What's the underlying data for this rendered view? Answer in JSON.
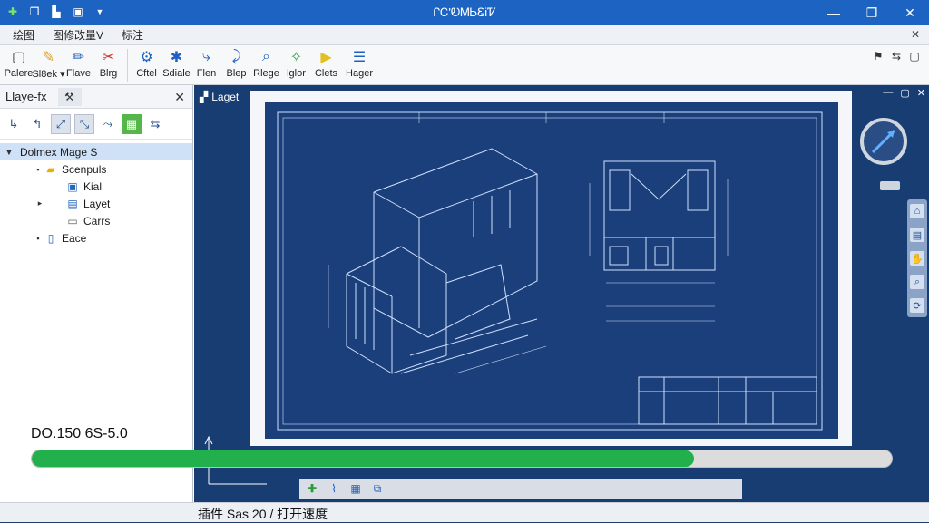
{
  "app": {
    "title": "ᒋᏟ'ᎧᎷᏏᏋᎥᏤ"
  },
  "quick_access": [
    "plus-green-icon",
    "copy-icon",
    "save-icon",
    "save-as-icon",
    "dropdown-icon"
  ],
  "window_controls": [
    "minimize-icon",
    "restore-icon",
    "close-icon"
  ],
  "menu": {
    "items": [
      "绘图",
      "图修改量V",
      "标注"
    ],
    "close": "✕"
  },
  "ribbon": {
    "buttons": [
      {
        "label": "Palere",
        "icon": "▢"
      },
      {
        "label": "Sl8ek ▾",
        "icon": "✎"
      },
      {
        "label": "Flave",
        "icon": "✏"
      },
      {
        "label": "Blrg",
        "icon": "✂"
      },
      {
        "label": "Cftel",
        "icon": "⚙"
      },
      {
        "label": "Sdiale",
        "icon": "✱"
      },
      {
        "label": "Flen",
        "icon": "⤷"
      },
      {
        "label": "Blep",
        "icon": "⤸"
      },
      {
        "label": "Rlege",
        "icon": "⌕"
      },
      {
        "label": "lglor",
        "icon": "✧"
      },
      {
        "label": "Clets",
        "icon": "▶"
      },
      {
        "label": "Hager",
        "icon": "☰"
      }
    ],
    "right_icons": [
      "⚑",
      "⇆",
      "▢"
    ]
  },
  "panel": {
    "title": "Llaye-fx",
    "tab_icon": "✕",
    "close": "✕",
    "tools": [
      "↳",
      "↰",
      "⤢",
      "⤡",
      "⤳",
      "▦",
      "⇆"
    ],
    "tree": [
      {
        "label": "Dolmex Mage S",
        "level": 0,
        "type": "root",
        "selected": true,
        "twisty": "▼"
      },
      {
        "label": "Scenpuls",
        "level": 1,
        "type": "folder",
        "twisty": "▪"
      },
      {
        "label": "Kial",
        "level": 2,
        "type": "file",
        "twisty": ""
      },
      {
        "label": "Layet",
        "level": 2,
        "type": "file",
        "twisty": "▸"
      },
      {
        "label": "Carrs",
        "level": 2,
        "type": "folder-empty",
        "twisty": ""
      },
      {
        "label": "Eace",
        "level": 1,
        "type": "file",
        "twisty": "▪"
      }
    ]
  },
  "view": {
    "tab_label": "Laget",
    "controls": [
      "—",
      "▢",
      "✕"
    ],
    "vtools": [
      "⌂",
      "▤",
      "✋",
      "⌕",
      "⟳"
    ]
  },
  "zoom_text": "DO.150 6S-5.0",
  "progress": {
    "value": 0.77,
    "color": "#21b04b"
  },
  "mini_toolbar": [
    "✚",
    "⌇",
    "▦",
    "⧉"
  ],
  "status": {
    "text": "插件 Sas 20 / 打开速度"
  },
  "colors": {
    "titlebar": "#1c63c2",
    "drawing_bg": "#1b3f7a",
    "lines": "#cfe0ff"
  }
}
